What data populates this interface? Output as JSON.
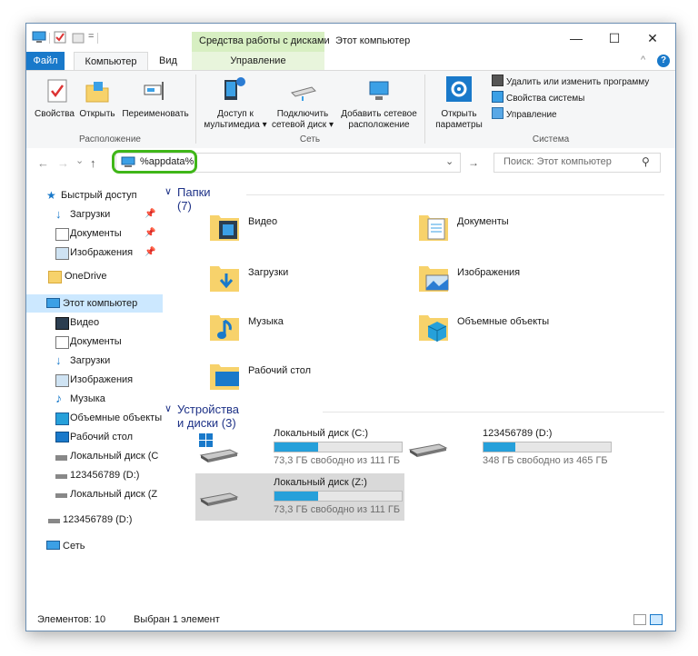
{
  "title_bar": {
    "context_tab_title": "Средства работы с дисками",
    "window_title": "Этот компьютер",
    "minimize": "—",
    "maximize": "☐",
    "close": "✕"
  },
  "ribbon_tabs": {
    "file": "Файл",
    "computer": "Компьютер",
    "view": "Вид",
    "manage": "Управление",
    "collapse": "^",
    "help": "?"
  },
  "ribbon": {
    "location": {
      "label": "Расположение",
      "properties": "Свойства",
      "open": "Открыть",
      "rename": "Переименовать"
    },
    "network": {
      "label": "Сеть",
      "media_access_1": "Доступ к",
      "media_access_2": "мультимедиа ▾",
      "map_drive_1": "Подключить",
      "map_drive_2": "сетевой диск ▾",
      "add_location_1": "Добавить сетевое",
      "add_location_2": "расположение"
    },
    "system": {
      "label": "Система",
      "open_settings_1": "Открыть",
      "open_settings_2": "параметры",
      "uninstall": "Удалить или изменить программу",
      "system_properties": "Свойства системы",
      "manage": "Управление"
    }
  },
  "address_bar": {
    "back": "←",
    "forward": "→",
    "recent": "⌄",
    "up": "↑",
    "path": "%appdata%",
    "dropdown": "⌄",
    "go": "→",
    "search_placeholder": "Поиск: Этот компьютер",
    "search_icon": "⚲"
  },
  "nav_pane": {
    "quick_access": "Быстрый доступ",
    "qa_downloads": "Загрузки",
    "qa_documents": "Документы",
    "qa_pictures": "Изображения",
    "onedrive": "OneDrive",
    "this_pc": "Этот компьютер",
    "video": "Видео",
    "documents": "Документы",
    "downloads": "Загрузки",
    "pictures": "Изображения",
    "music": "Музыка",
    "objects3d": "Объемные объекты",
    "desktop": "Рабочий стол",
    "local_c": "Локальный диск (C",
    "drive_d": "123456789 (D:)",
    "local_z": "Локальный диск (Z",
    "drive_d2": "123456789 (D:)",
    "network": "Сеть"
  },
  "content": {
    "folders_header": "Папки (7)",
    "folders": {
      "video": "Видео",
      "documents": "Документы",
      "downloads": "Загрузки",
      "pictures": "Изображения",
      "music": "Музыка",
      "objects3d": "Объемные объекты",
      "desktop": "Рабочий стол"
    },
    "drives_header": "Устройства и диски (3)",
    "drives": {
      "c_name": "Локальный диск (C:)",
      "c_free": "73,3 ГБ свободно из 111 ГБ",
      "c_used_fraction": 0.34,
      "d_name": "123456789 (D:)",
      "d_free": "348 ГБ свободно из 465 ГБ",
      "d_used_fraction": 0.25,
      "z_name": "Локальный диск (Z:)",
      "z_free": "73,3 ГБ свободно из 111 ГБ",
      "z_used_fraction": 0.34
    }
  },
  "status_bar": {
    "items": "Элементов: 10",
    "selected": "Выбран 1 элемент"
  },
  "colors": {
    "accent": "#1979ca",
    "context_tab": "#d7efc2",
    "highlight": "#3fb618",
    "bar_fill": "#26a0da",
    "folder": "#f7d26b"
  }
}
